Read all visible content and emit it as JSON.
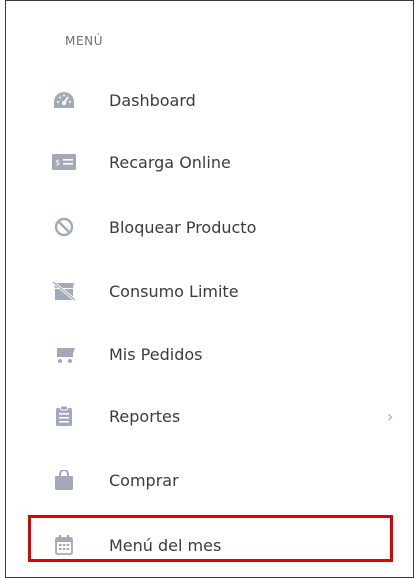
{
  "menu": {
    "heading": "MENÚ",
    "items": [
      {
        "label": "Dashboard",
        "icon": "dashboard-gauge-icon"
      },
      {
        "label": "Recarga Online",
        "icon": "money-bill-icon"
      },
      {
        "label": "Bloquear Producto",
        "icon": "block-icon"
      },
      {
        "label": "Consumo Limite",
        "icon": "store-slash-icon"
      },
      {
        "label": "Mis Pedidos",
        "icon": "cart-icon"
      },
      {
        "label": "Reportes",
        "icon": "clipboard-icon",
        "has_submenu": true
      },
      {
        "label": "Comprar",
        "icon": "shopping-bag-icon"
      },
      {
        "label": "Menú del mes",
        "icon": "calendar-icon"
      }
    ],
    "chevron": "›"
  },
  "colors": {
    "text": "#3a3a46",
    "heading": "#6e6e7a",
    "icon": "#a3a9b9",
    "highlight": "#e10000",
    "border": "#3a3a3a"
  }
}
